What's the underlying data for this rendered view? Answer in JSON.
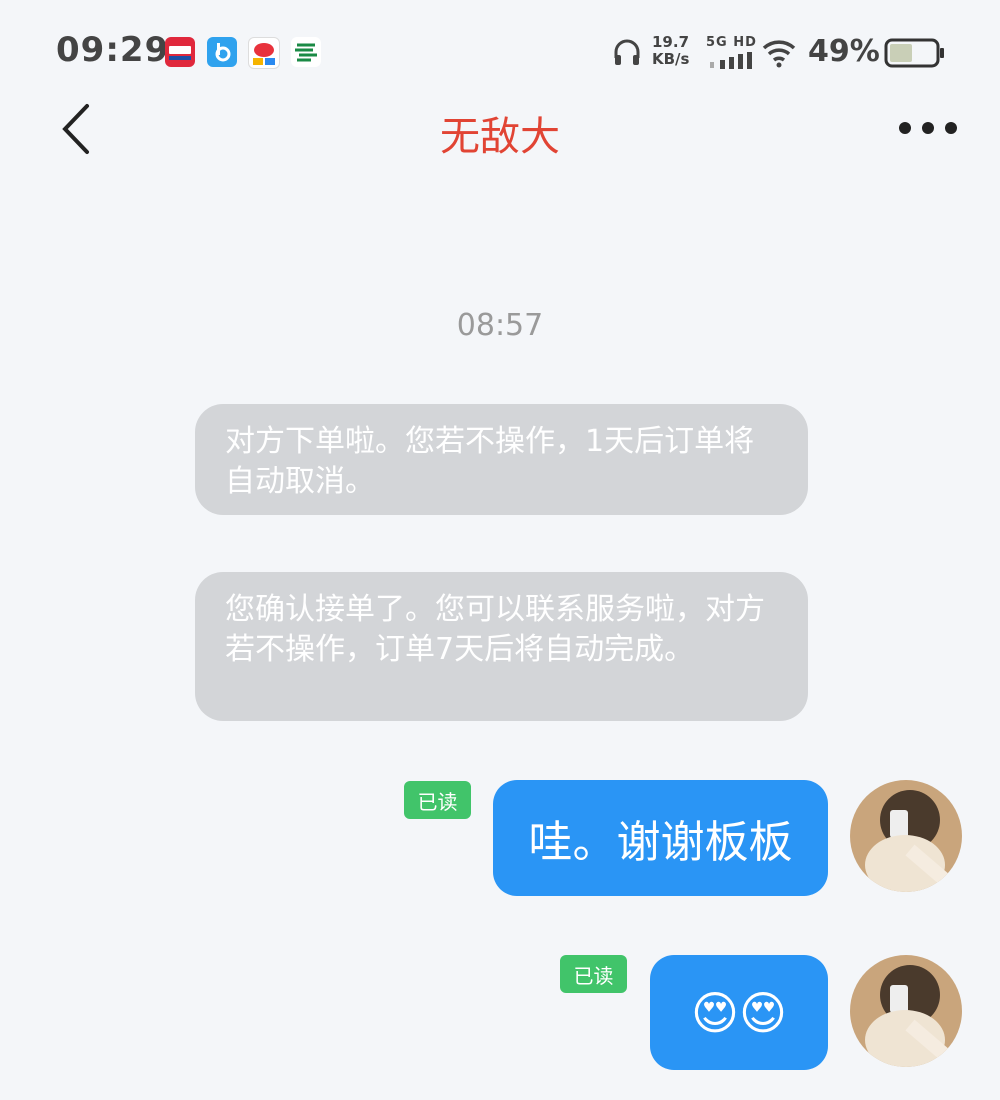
{
  "status_bar": {
    "time": "09:29",
    "app_icons": [
      "xiaohongshu-icon",
      "baidu-icon",
      "chat-app-icon",
      "china-post-icon"
    ],
    "headset_icon": "headphones-icon",
    "net_speed_value": "19.7",
    "net_speed_unit": "KB/s",
    "network_type": "5G HD",
    "battery_percent": "49%",
    "battery_level": 0.49
  },
  "nav": {
    "back_icon": "chevron-left-icon",
    "title": "无敌大",
    "more_icon": "more-dots-icon",
    "title_color": "#e14434"
  },
  "chat": {
    "timestamp": "08:57",
    "system_messages": [
      {
        "text": "对方下单啦。您若不操作，1天后订单将自动取消。"
      },
      {
        "text": "您确认接单了。您可以联系服务啦，对方若不操作，订单7天后将自动完成。"
      }
    ],
    "my_messages": [
      {
        "text": "哇。谢谢板板",
        "read_label": "已读"
      },
      {
        "text": "😍😍",
        "read_label": "已读"
      }
    ],
    "bubble_color": "#2a95f5",
    "read_badge_color": "#41c46a"
  }
}
